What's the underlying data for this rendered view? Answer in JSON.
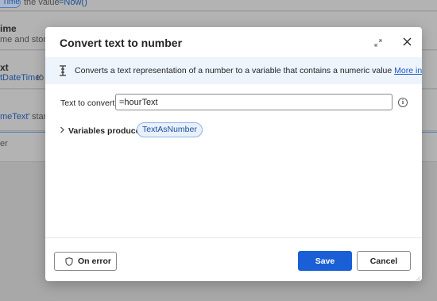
{
  "background": {
    "rows": [
      {
        "chip_text": "Time",
        "text": "the value",
        "value": "=Now()"
      },
      {
        "bold": "ime",
        "text": "me and store it"
      },
      {
        "bold": "xt",
        "var": "tDateTime'",
        "text": "to"
      },
      {
        "var": "meText'",
        "text": "starting"
      },
      {
        "text": "er"
      }
    ]
  },
  "dialog": {
    "title": "Convert text to number",
    "info": {
      "text": "Converts a text representation of a number to a variable that contains a numeric value",
      "link": "More info"
    },
    "field": {
      "label": "Text to convert:",
      "value": "=hourText"
    },
    "variables": {
      "label": "Variables produced",
      "chip": "TextAsNumber"
    },
    "footer": {
      "on_error": "On error",
      "save": "Save",
      "cancel": "Cancel"
    }
  },
  "colors": {
    "primary": "#1a5fd6",
    "info_bg": "#eef4fc",
    "link": "#1a56c4"
  }
}
